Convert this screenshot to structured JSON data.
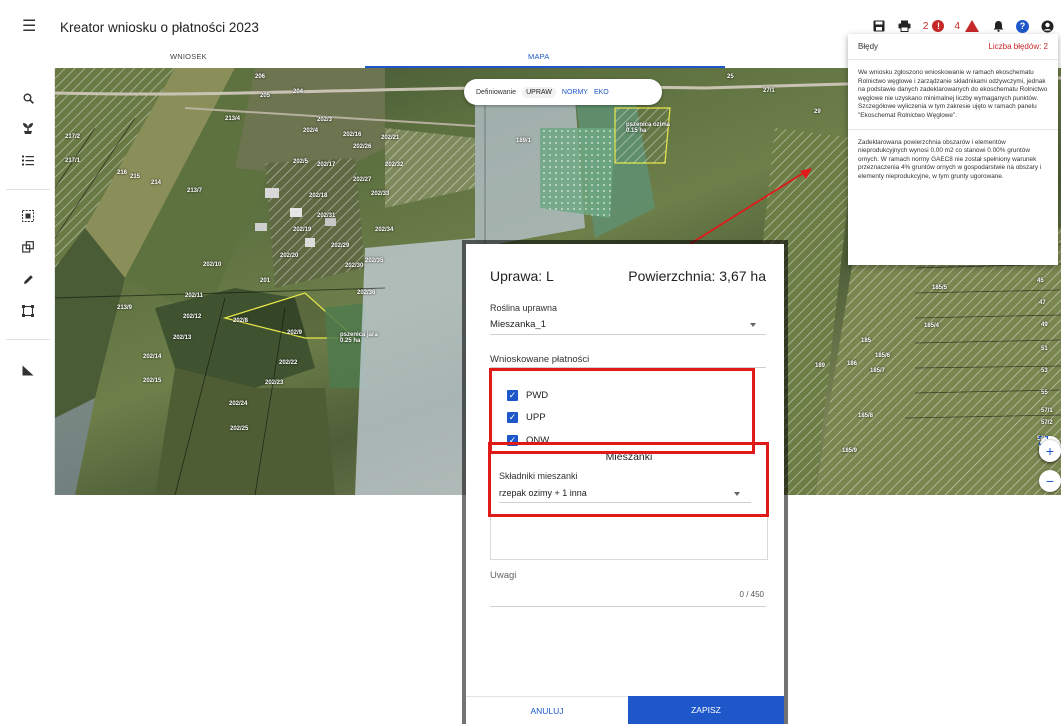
{
  "header": {
    "menu_icon": "hamburger-menu-icon",
    "title": "Kreator wniosku o płatności 2023",
    "notif_count_a": "2",
    "notif_count_b": "4",
    "icons": [
      "save-icon",
      "print-icon",
      "error-icon",
      "warning-icon",
      "bell-icon",
      "help-icon",
      "account-icon"
    ]
  },
  "tabs": [
    {
      "label": "WNIOSEK",
      "active": false
    },
    {
      "label": "MAPA",
      "active": true
    }
  ],
  "layers": {
    "definiowanie": "Definiowanie",
    "upraw": "UPRAW",
    "normy": "NORMY",
    "eko": "EKO"
  },
  "errors_panel": {
    "title": "Błędy",
    "count_label": "Liczba błędów: 2",
    "messages": [
      "We wniosku zgłoszono wnioskowanie w ramach ekoschematu Rolnictwo węglowe i zarządzanie składnikami odżywczymi, jednak na podstawie danych zadeklarowanych do ekoschematu Rolnictwo węglowe nie uzyskano minimalnej liczby wymaganych punktów. Szczegółowe wyliczenia w tym zakresie ujęto w ramach panelu \"Ekoschemat Rolnictwo Węglowe\".",
      "Zadeklarowana powierzchnia obszarów i elementów nieprodukcyjnych wynosi 0.00 m2 co stanowi 0.00% gruntów ornych. W ramach normy GAEC8 nie został spełniony warunek przeznaczenia 4% gruntów ornych w gospodarstwie na obszary i elementy nieprodukcyjne, w tym grunty ugorowane."
    ]
  },
  "map": {
    "labels": [
      "206",
      "205",
      "204",
      "213/4",
      "202/3",
      "217/2",
      "202/4",
      "202/16",
      "202/21",
      "202/26",
      "217/1",
      "216",
      "215",
      "214",
      "202/5",
      "202/17",
      "202/32",
      "202/27",
      "213/7",
      "202/18",
      "202/33",
      "202/31",
      "202/19",
      "202/34",
      "202/20",
      "202/29",
      "202/30",
      "202/35",
      "202/10",
      "201",
      "202/36",
      "213/9",
      "202/11",
      "202/12",
      "202/13",
      "202/14",
      "202/15",
      "202/22",
      "202/23",
      "202/24",
      "202/25",
      "202/8",
      "202/9",
      "189/1",
      "25",
      "27/1",
      "29",
      "185/5",
      "185/4",
      "185/6",
      "185/7",
      "185/8",
      "185/9",
      "45",
      "47",
      "49",
      "51",
      "53",
      "55",
      "57/1",
      "57/2",
      "59/2",
      "189",
      "186",
      "185"
    ],
    "crop_labels": [
      {
        "name": "pszenica ozima",
        "area": "0.15 ha"
      },
      {
        "name": "pszenica jara",
        "area": "0.25 ha"
      }
    ],
    "controls": [
      "fullscreen-icon",
      "zoom-in-icon",
      "zoom-out-icon"
    ]
  },
  "dialog": {
    "title": "Uprawa: L",
    "area": "Powierzchnia: 3,67 ha",
    "crop_label": "Roślina uprawna",
    "crop_value": "Mieszanka_1",
    "payments_label": "Wnioskowane płatności",
    "payments": [
      {
        "label": "PWD",
        "checked": true
      },
      {
        "label": "UPP",
        "checked": true
      },
      {
        "label": "ONW",
        "checked": true
      }
    ],
    "mix_header": "Mieszanki",
    "mix_components_label": "Składniki mieszanki",
    "mix_components_value": "rzepak ozimy + 1 inna",
    "notes_label": "Uwagi",
    "notes_counter": "0 / 450",
    "cancel_label": "ANULUJ",
    "save_label": "ZAPISZ"
  },
  "colors": {
    "accent": "#1e57c9",
    "error": "#c62828",
    "highlight": "#e01919"
  }
}
